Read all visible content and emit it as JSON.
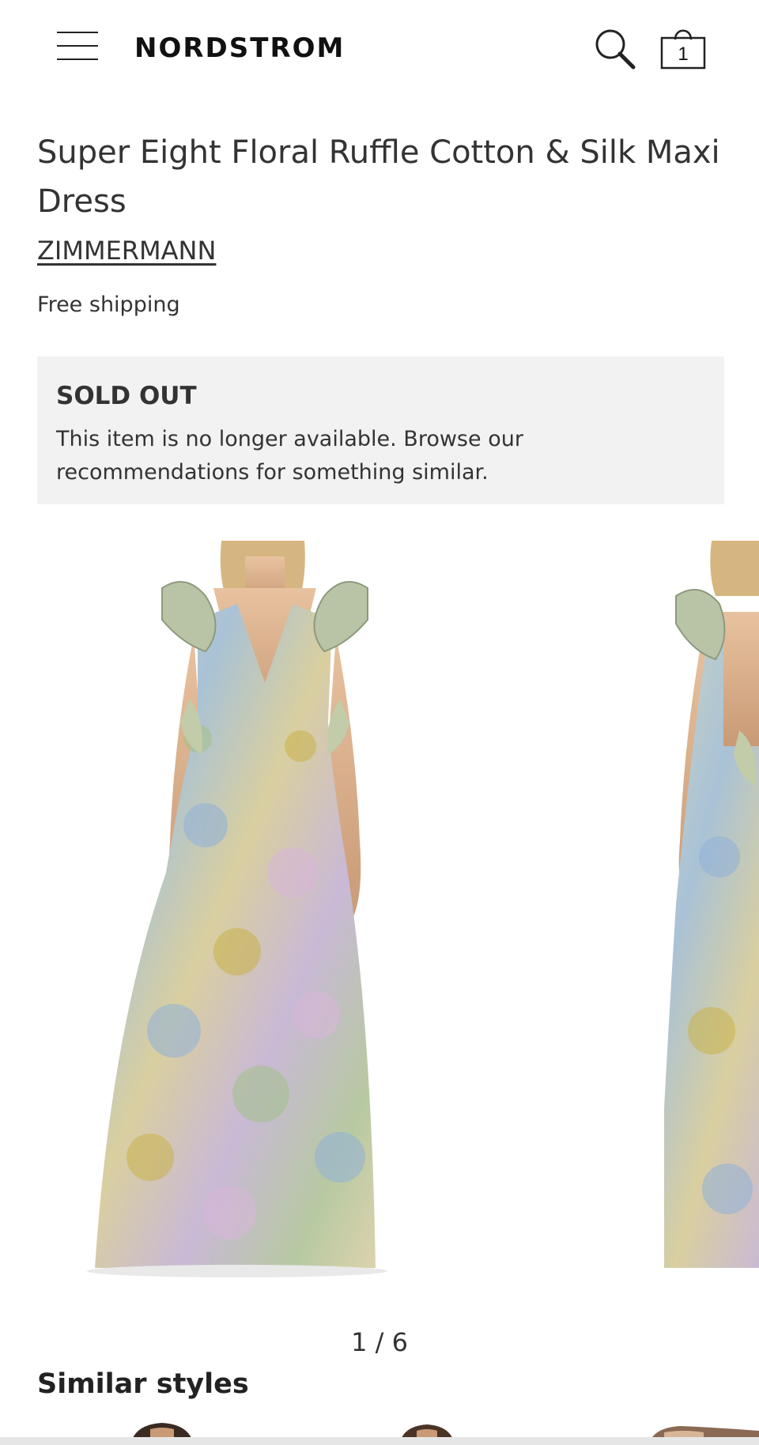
{
  "header": {
    "logo_text": "NORDSTROM",
    "bag_count": "1",
    "icons": {
      "menu": "hamburger-menu-icon",
      "search": "search-icon",
      "bag": "shopping-bag-icon"
    }
  },
  "product": {
    "title": "Super Eight Floral Ruffle Cotton & Silk Maxi Dress",
    "brand": "ZIMMERMANN",
    "shipping": "Free shipping"
  },
  "availability": {
    "status": "SOLD OUT",
    "message": "This item is no longer available. Browse our recommendations for something similar."
  },
  "gallery": {
    "pager": "1 / 6"
  },
  "similar": {
    "heading": "Similar styles"
  },
  "colors": {
    "soldout_background": "#f2f2f2",
    "text_primary": "#333333",
    "logo": "#111111"
  }
}
